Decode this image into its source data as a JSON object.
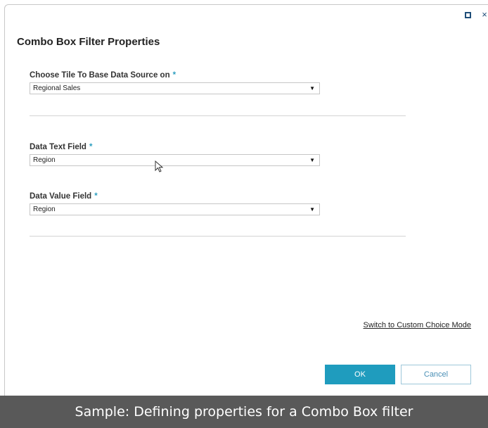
{
  "dialog": {
    "title": "Combo Box Filter Properties",
    "required_marker": "*"
  },
  "fields": {
    "tile_source": {
      "label": "Choose Tile To Base Data Source on",
      "value": "Regional Sales"
    },
    "data_text": {
      "label": "Data Text Field",
      "value": "Region"
    },
    "data_value": {
      "label": "Data Value Field",
      "value": "Region"
    }
  },
  "links": {
    "switch_mode": "Switch to Custom Choice Mode"
  },
  "buttons": {
    "ok": "OK",
    "cancel": "Cancel"
  },
  "caption": {
    "text": "Sample: Defining properties for a Combo Box filter"
  },
  "icons": {
    "caret": "▼",
    "close": "×",
    "maximize": "maximize-icon",
    "cursor": "mouse-pointer-icon"
  },
  "colors": {
    "accent": "#1f9cbe",
    "required": "#2e9fc0",
    "caption_bg": "#595959",
    "window_control": "#1f4e79"
  }
}
